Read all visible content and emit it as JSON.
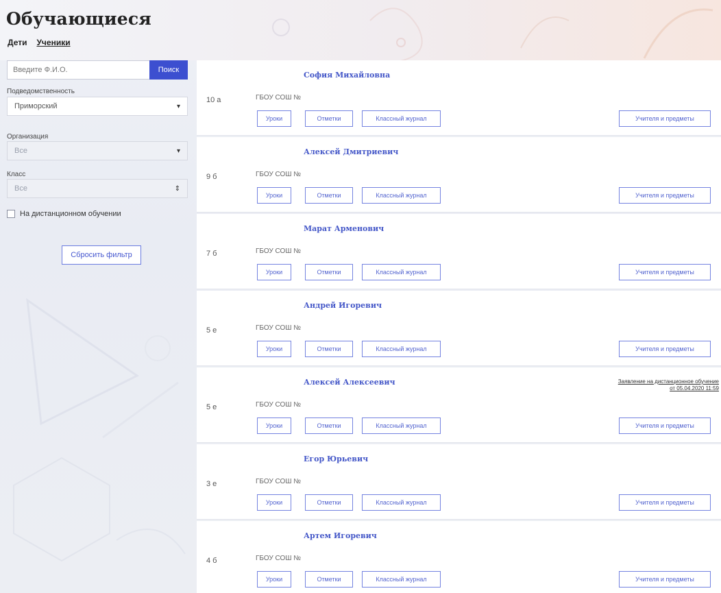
{
  "header": {
    "title": "Обучающиеся",
    "tabs": [
      {
        "label": "Дети",
        "active": false
      },
      {
        "label": "Ученики",
        "active": true
      }
    ]
  },
  "sidebar": {
    "search": {
      "placeholder": "Введите Ф.И.О.",
      "value": "",
      "button_label": "Поиск"
    },
    "subordination": {
      "label": "Подведомственность",
      "value": "Приморский"
    },
    "organization": {
      "label": "Организация",
      "value": "Все"
    },
    "class": {
      "label": "Класс",
      "value": "Все"
    },
    "distance_checkbox": {
      "label": "На дистанционном обучении",
      "checked": false
    },
    "reset_button": "Сбросить фильтр"
  },
  "buttons": {
    "lessons": "Уроки",
    "marks": "Отметки",
    "journal": "Классный журнал",
    "teachers": "Учителя и предметы"
  },
  "students": [
    {
      "name": "София Михайловна",
      "grade": "10 а",
      "school": "ГБОУ СОШ №"
    },
    {
      "name": "Алексей Дмитриевич",
      "grade": "9 б",
      "school": "ГБОУ СОШ №"
    },
    {
      "name": "Марат Арменович",
      "grade": "7 б",
      "school": "ГБОУ СОШ №"
    },
    {
      "name": "Андрей Игоревич",
      "grade": "5 е",
      "school": "ГБОУ СОШ №"
    },
    {
      "name": "Алексей Алексеевич",
      "grade": "5 е",
      "school": "ГБОУ СОШ №",
      "note": "Заявление на дистанционное обучение от 05.04.2020 11:59"
    },
    {
      "name": "Егор Юрьевич",
      "grade": "3 е",
      "school": "ГБОУ СОШ №"
    },
    {
      "name": "Артем Игоревич",
      "grade": "4 б",
      "school": "ГБОУ СОШ №"
    }
  ],
  "colors": {
    "accent": "#3c4fd0",
    "link": "#4457c8",
    "button_border": "#7382e0"
  }
}
